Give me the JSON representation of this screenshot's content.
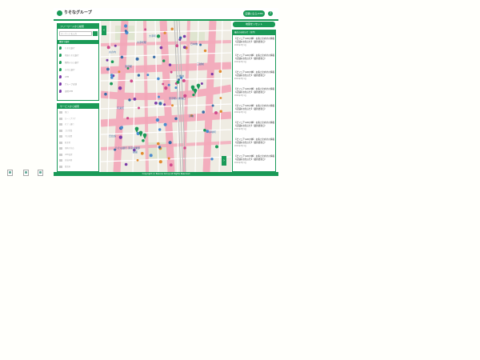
{
  "header": {
    "logo_text": "りそなグループ",
    "action_label": "店舗に戻る/ATM",
    "help_label": "?"
  },
  "left": {
    "search_panel": {
      "title": "フリーワードから検索",
      "placeholder": "キーワードを入力",
      "category_title": "種別で検索",
      "categories": [
        {
          "label": "りそな銀行",
          "color": "#1a9a57"
        },
        {
          "label": "埼玉りそな銀行",
          "color": "#1a9a57"
        },
        {
          "label": "関西みらい銀行",
          "color": "#1a9a57"
        },
        {
          "label": "みなと銀行",
          "color": "#1a9a57"
        },
        {
          "label": "ATM",
          "color": "#7a3aa8"
        },
        {
          "label": "グループ店舗",
          "color": "#7a3aa8"
        },
        {
          "label": "提携ATM",
          "color": "#7a3aa8"
        }
      ]
    },
    "service_panel": {
      "title": "サービスから検索",
      "services": [
        "窓口",
        "ローンプラザ",
        "セブン銀行",
        "土日営業",
        "平日夜間",
        "駐車場",
        "車椅子対応",
        "AED設置",
        "外貨両替",
        "貸金庫"
      ]
    }
  },
  "map": {
    "labels": [
      "東京駅",
      "丸の内",
      "大手町",
      "八重洲",
      "日本橋",
      "京橋",
      "有楽町",
      "銀座",
      "東京駅八重洲口",
      "日比谷",
      "大手町駅",
      "りそな銀行 東京営業部",
      "三越前",
      "茅場町"
    ]
  },
  "right": {
    "top_button": "地図をリセット",
    "news_title": "最近のお知らせ（全件）",
    "news": [
      {
        "text": "【ビジュアルIDの体】 お客さま向けの情報【店舗のお知らせ】（最新更新日）",
        "date": "2024年5月1日"
      },
      {
        "text": "【ビジュアルIDの体】 お客さま向けの情報【店舗のお知らせ】（最新更新日）",
        "date": "2024年5月1日"
      },
      {
        "text": "【ビジュアルIDの体】 お客さま向けの情報【店舗のお知らせ】（最新更新日）",
        "date": "2024年5月1日"
      },
      {
        "text": "【ビジュアルIDの体】 お客さま向けの情報【店舗のお知らせ】（最新更新日）",
        "date": "2024年5月1日"
      },
      {
        "text": "【ビジュアルIDの体】 お客さま向けの情報【店舗のお知らせ】（最新更新日）",
        "date": "2024年5月1日"
      },
      {
        "text": "【ビジュアルIDの体】 お客さま向けの情報【店舗のお知らせ】（最新更新日）",
        "date": "2024年5月1日"
      },
      {
        "text": "【ビジュアルIDの体】 お客さま向けの情報【店舗のお知らせ】（最新更新日）",
        "date": "2024年5月1日"
      },
      {
        "text": "【ビジュアルIDの体】 お客さま向けの情報【店舗のお知らせ】（最新更新日）",
        "date": "2024年5月1日"
      }
    ]
  },
  "footer": {
    "copyright": "Copyright (c) Resona Group All Rights Reserved"
  },
  "colors": {
    "brand": "#1a9a57",
    "pin_purple": "#7a3aa8",
    "map_road_pink": "#f4a7b9"
  }
}
